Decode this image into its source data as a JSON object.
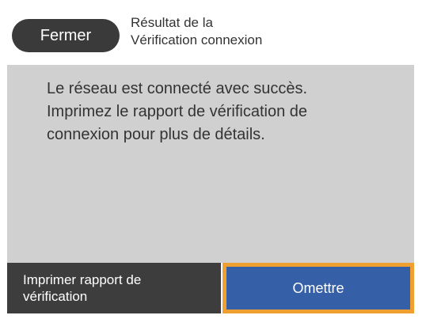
{
  "header": {
    "close_label": "Fermer",
    "title_line1": "Résultat de la",
    "title_line2": "Vérification connexion"
  },
  "message": {
    "line1": "Le réseau est connecté avec succès.",
    "line2": "Imprimez le rapport de vérification de",
    "line3": "connexion pour plus de détails."
  },
  "footer": {
    "print_label_line1": "Imprimer rapport de",
    "print_label_line2": "vérification",
    "skip_label": "Omettre"
  },
  "colors": {
    "close_button_bg": "#3a3a3a",
    "content_bg": "#d0d0d0",
    "print_button_bg": "#3d3d3d",
    "skip_button_bg": "#3560a8",
    "focus_border": "#f0a030"
  }
}
